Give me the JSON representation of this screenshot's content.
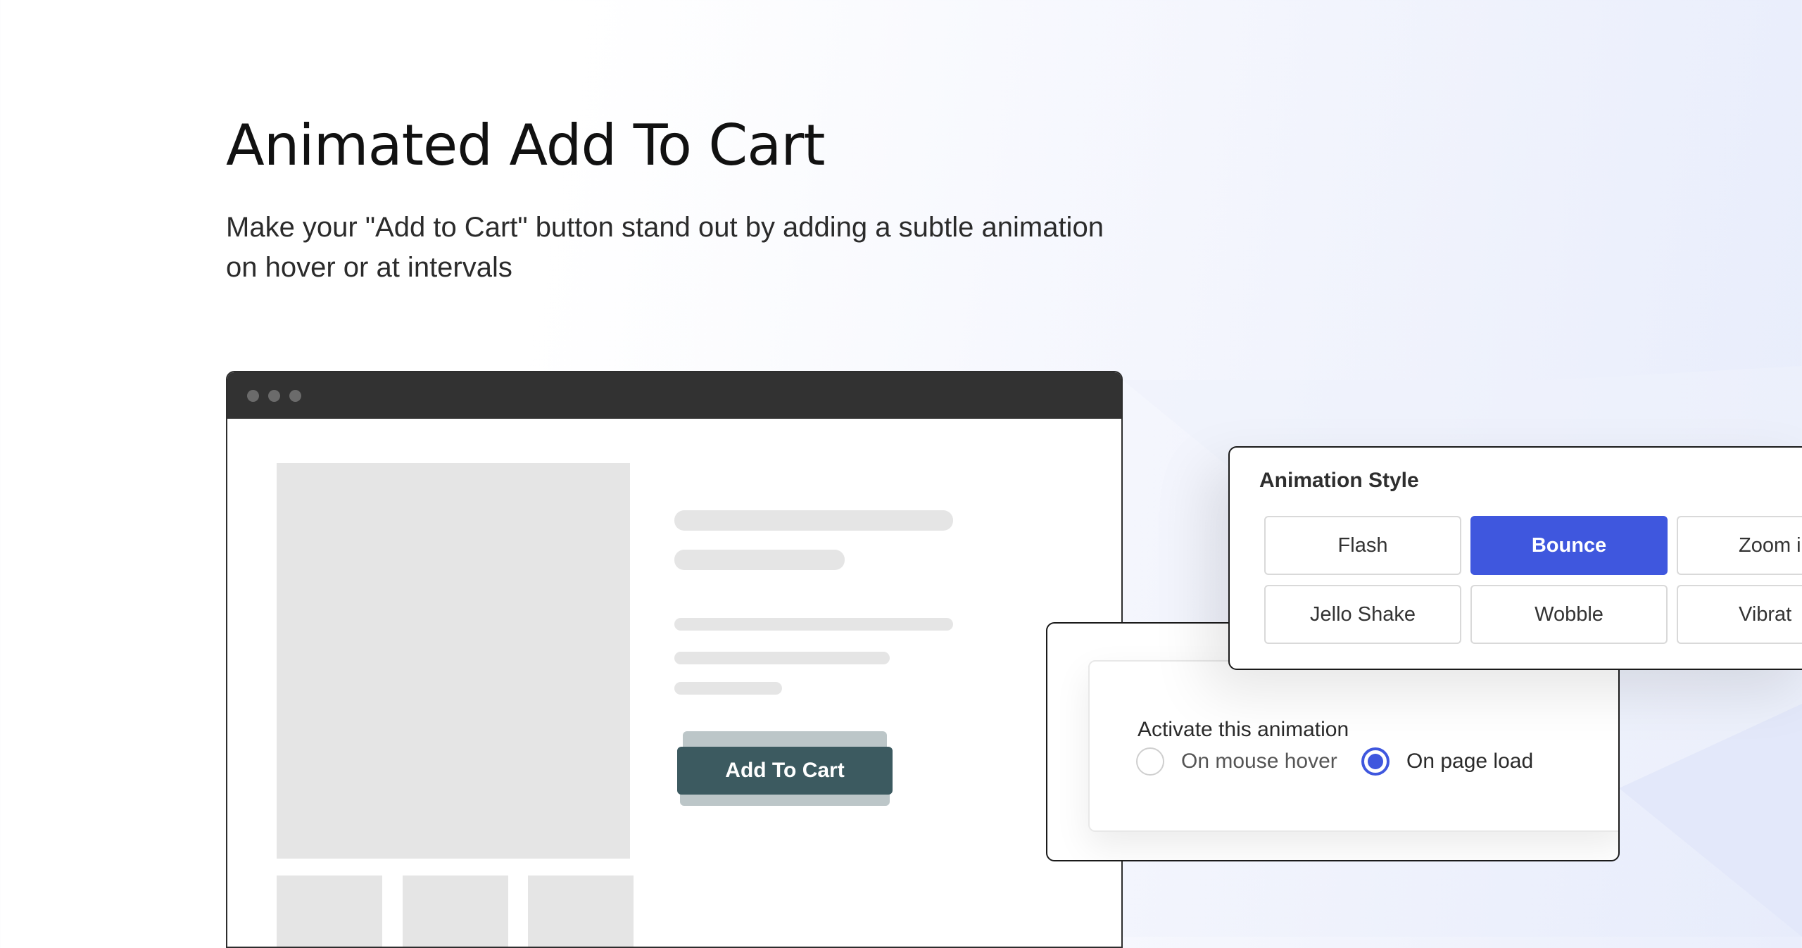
{
  "page": {
    "title": "Animated Add To Cart",
    "subtitle": "Make your \"Add to Cart\" button stand out by adding a subtle animation on hover or at intervals"
  },
  "product": {
    "add_to_cart_label": "Add To Cart"
  },
  "animation_style": {
    "heading": "Animation Style",
    "options": [
      "Flash",
      "Bounce",
      "Zoom i",
      "Jello Shake",
      "Wobble",
      "Vibrat"
    ],
    "selected": "Bounce"
  },
  "activation": {
    "label": "Activate this animation",
    "options": [
      "On mouse hover",
      "On page load"
    ],
    "selected": "On page load"
  },
  "colors": {
    "accent": "#3f57de",
    "cart_button": "#3c5a60",
    "browser_bar": "#323232",
    "placeholder": "#e5e5e5"
  }
}
